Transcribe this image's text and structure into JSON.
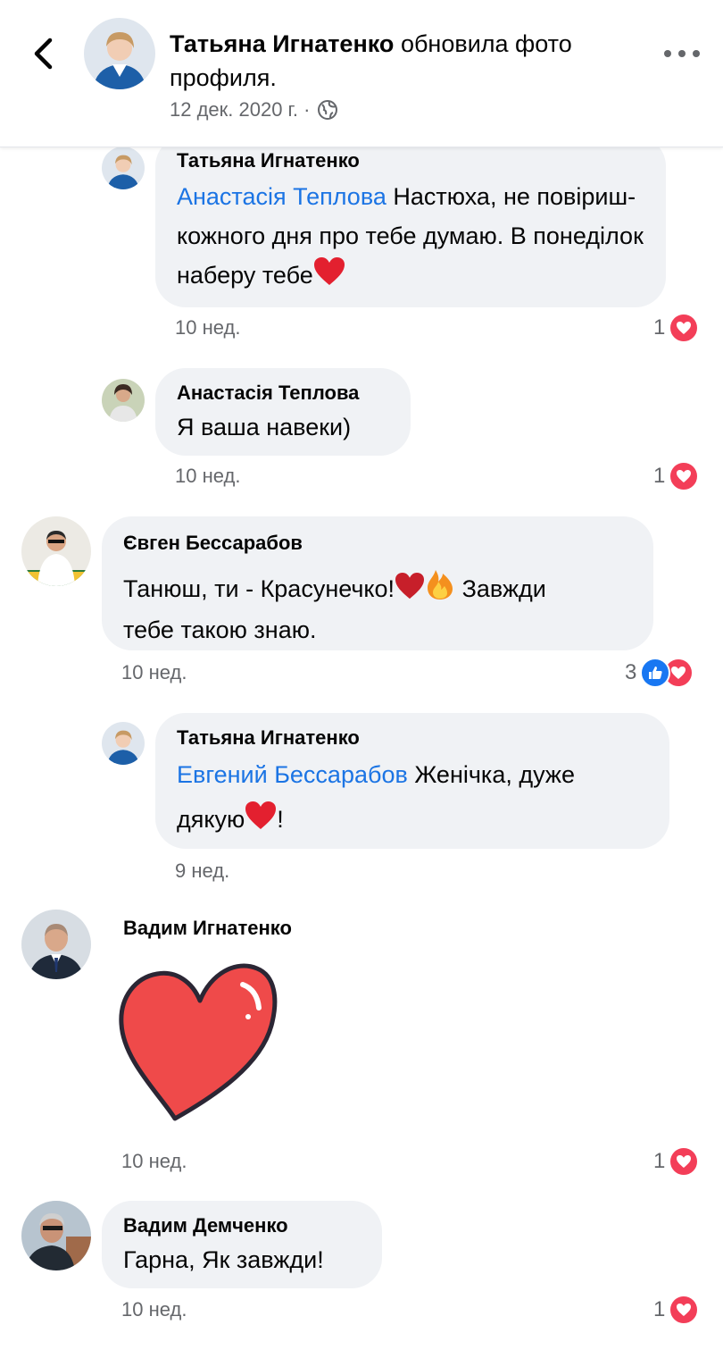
{
  "header": {
    "author": "Татьяна Игнатенко",
    "action": "обновила фото профиля.",
    "date": "12 дек. 2020 г. ·",
    "globe_icon": "globe-icon",
    "back_icon": "chevron-left-icon",
    "more_icon": "more-horizontal-icon"
  },
  "comments": [
    {
      "name": "Татьяна Игнатенко",
      "mention": "Анастасія Теплова",
      "text": "Настюха, не повіриш-кожного дня про тебе думаю. В понеділок наберу тебе",
      "time": "10 нед.",
      "reactions": "1"
    },
    {
      "name": "Анастасія Теплова",
      "text": "Я ваша навеки)",
      "time": "10 нед.",
      "reactions": "1"
    },
    {
      "name": "Євген Бессарабов",
      "text_line1": "Танюш, ти - Красунечко!",
      "text_line1_end": "Завжди",
      "text_line2": "тебе такою знаю.",
      "time": "10 нед.",
      "reactions": "3"
    },
    {
      "name": "Татьяна Игнатенко",
      "mention": "Евгений Бессарабов",
      "text_line1": "Женічка, дуже",
      "text_line2": "дякую",
      "text_line2_end": "!",
      "time": "9 нед."
    },
    {
      "name": "Вадим Игнатенко",
      "sticker": "heart-sticker",
      "time": "10 нед.",
      "reactions": "1"
    },
    {
      "name": "Вадим Демченко",
      "text": "Гарна, Як завжди!",
      "time": "10 нед.",
      "reactions": "1"
    }
  ],
  "colors": {
    "mention": "#1b74e4",
    "bubble": "#f0f2f5",
    "love": "#f33e58",
    "like": "#1877f2",
    "meta": "#65676b"
  }
}
